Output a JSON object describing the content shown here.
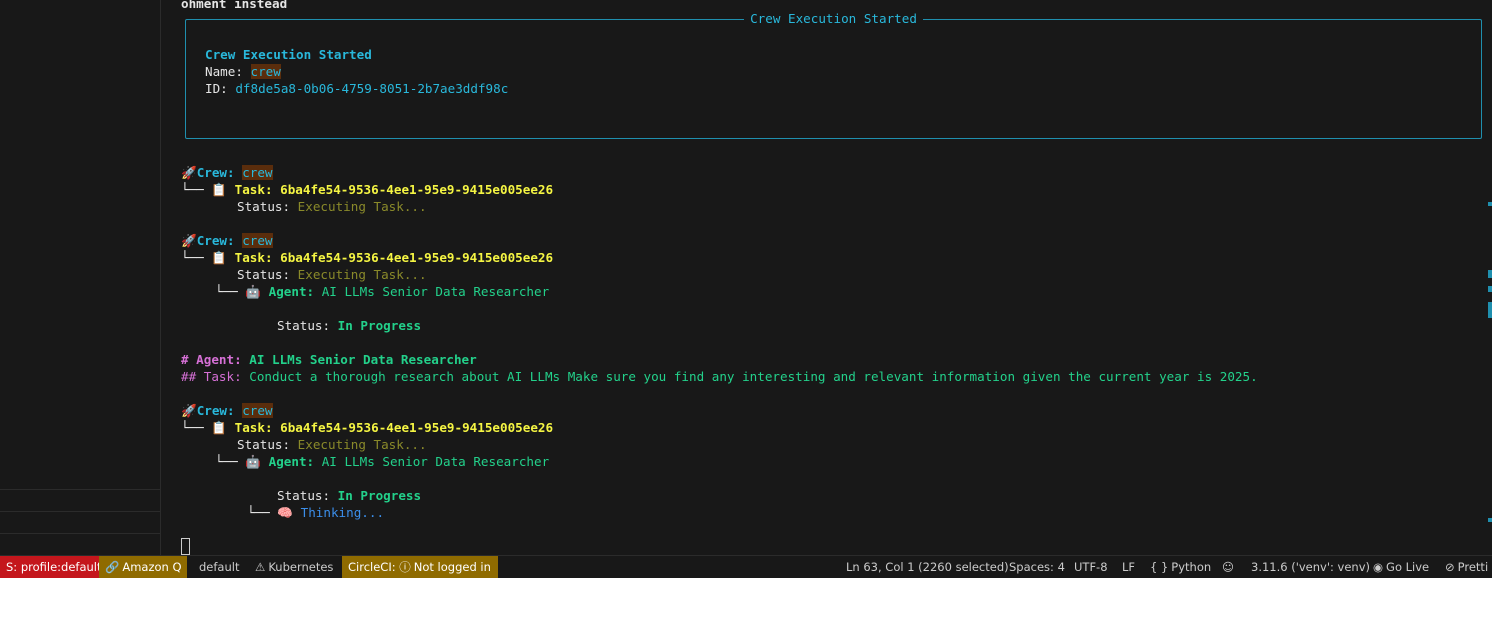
{
  "terminal": {
    "top_fragment": "ohment instead",
    "panel": {
      "title": "Crew Execution Started",
      "heading": "Crew Execution Started",
      "name_label": "Name: ",
      "name_value": "crew",
      "id_label": "ID: ",
      "id_value": "df8de5a8-0b06-4759-8051-2b7ae3ddf98c"
    },
    "crew_label": "Crew: ",
    "crew_name": "crew",
    "task_label": "Task: ",
    "task_id": "6ba4fe54-9536-4ee1-95e9-9415e005ee26",
    "status_label": "Status: ",
    "executing": "Executing Task...",
    "agent_label": "Agent: ",
    "agent_name": "AI LLMs Senior Data Researcher",
    "in_progress": "In Progress",
    "md_agent_prefix": "# Agent: ",
    "md_agent_name": "AI LLMs Senior Data Researcher",
    "md_task_prefix": "## Task: ",
    "md_task_text": "Conduct a thorough research about AI LLMs Make sure you find any interesting and relevant information given the current year is 2025.",
    "thinking": "Thinking...",
    "tree_branch": "└──",
    "emoji_rocket": "🚀",
    "emoji_clipboard": "📋",
    "emoji_robot": "🤖",
    "emoji_brain": "🧠"
  },
  "statusbar": {
    "aws_profile": "S: profile:default",
    "amazon_q": "Amazon Q",
    "default": "default",
    "kubernetes": "Kubernetes",
    "circleci": "CircleCI:",
    "circleci_status": "Not logged in",
    "cursor_pos": "Ln 63, Col 1 (2260 selected)",
    "spaces": "Spaces: 4",
    "encoding": "UTF-8",
    "eol": "LF",
    "language": "Python",
    "python_version": "3.11.6 ('venv': venv)",
    "go_live": "Go Live",
    "prettier": "Pretti"
  },
  "colors": {
    "accent_cyan": "#29b8db",
    "task_yellow": "#f5f543",
    "status_green": "#23d18b",
    "markdown_magenta": "#d670d6",
    "statusbar_red": "#c4161c",
    "statusbar_olive": "#8f6b00"
  }
}
